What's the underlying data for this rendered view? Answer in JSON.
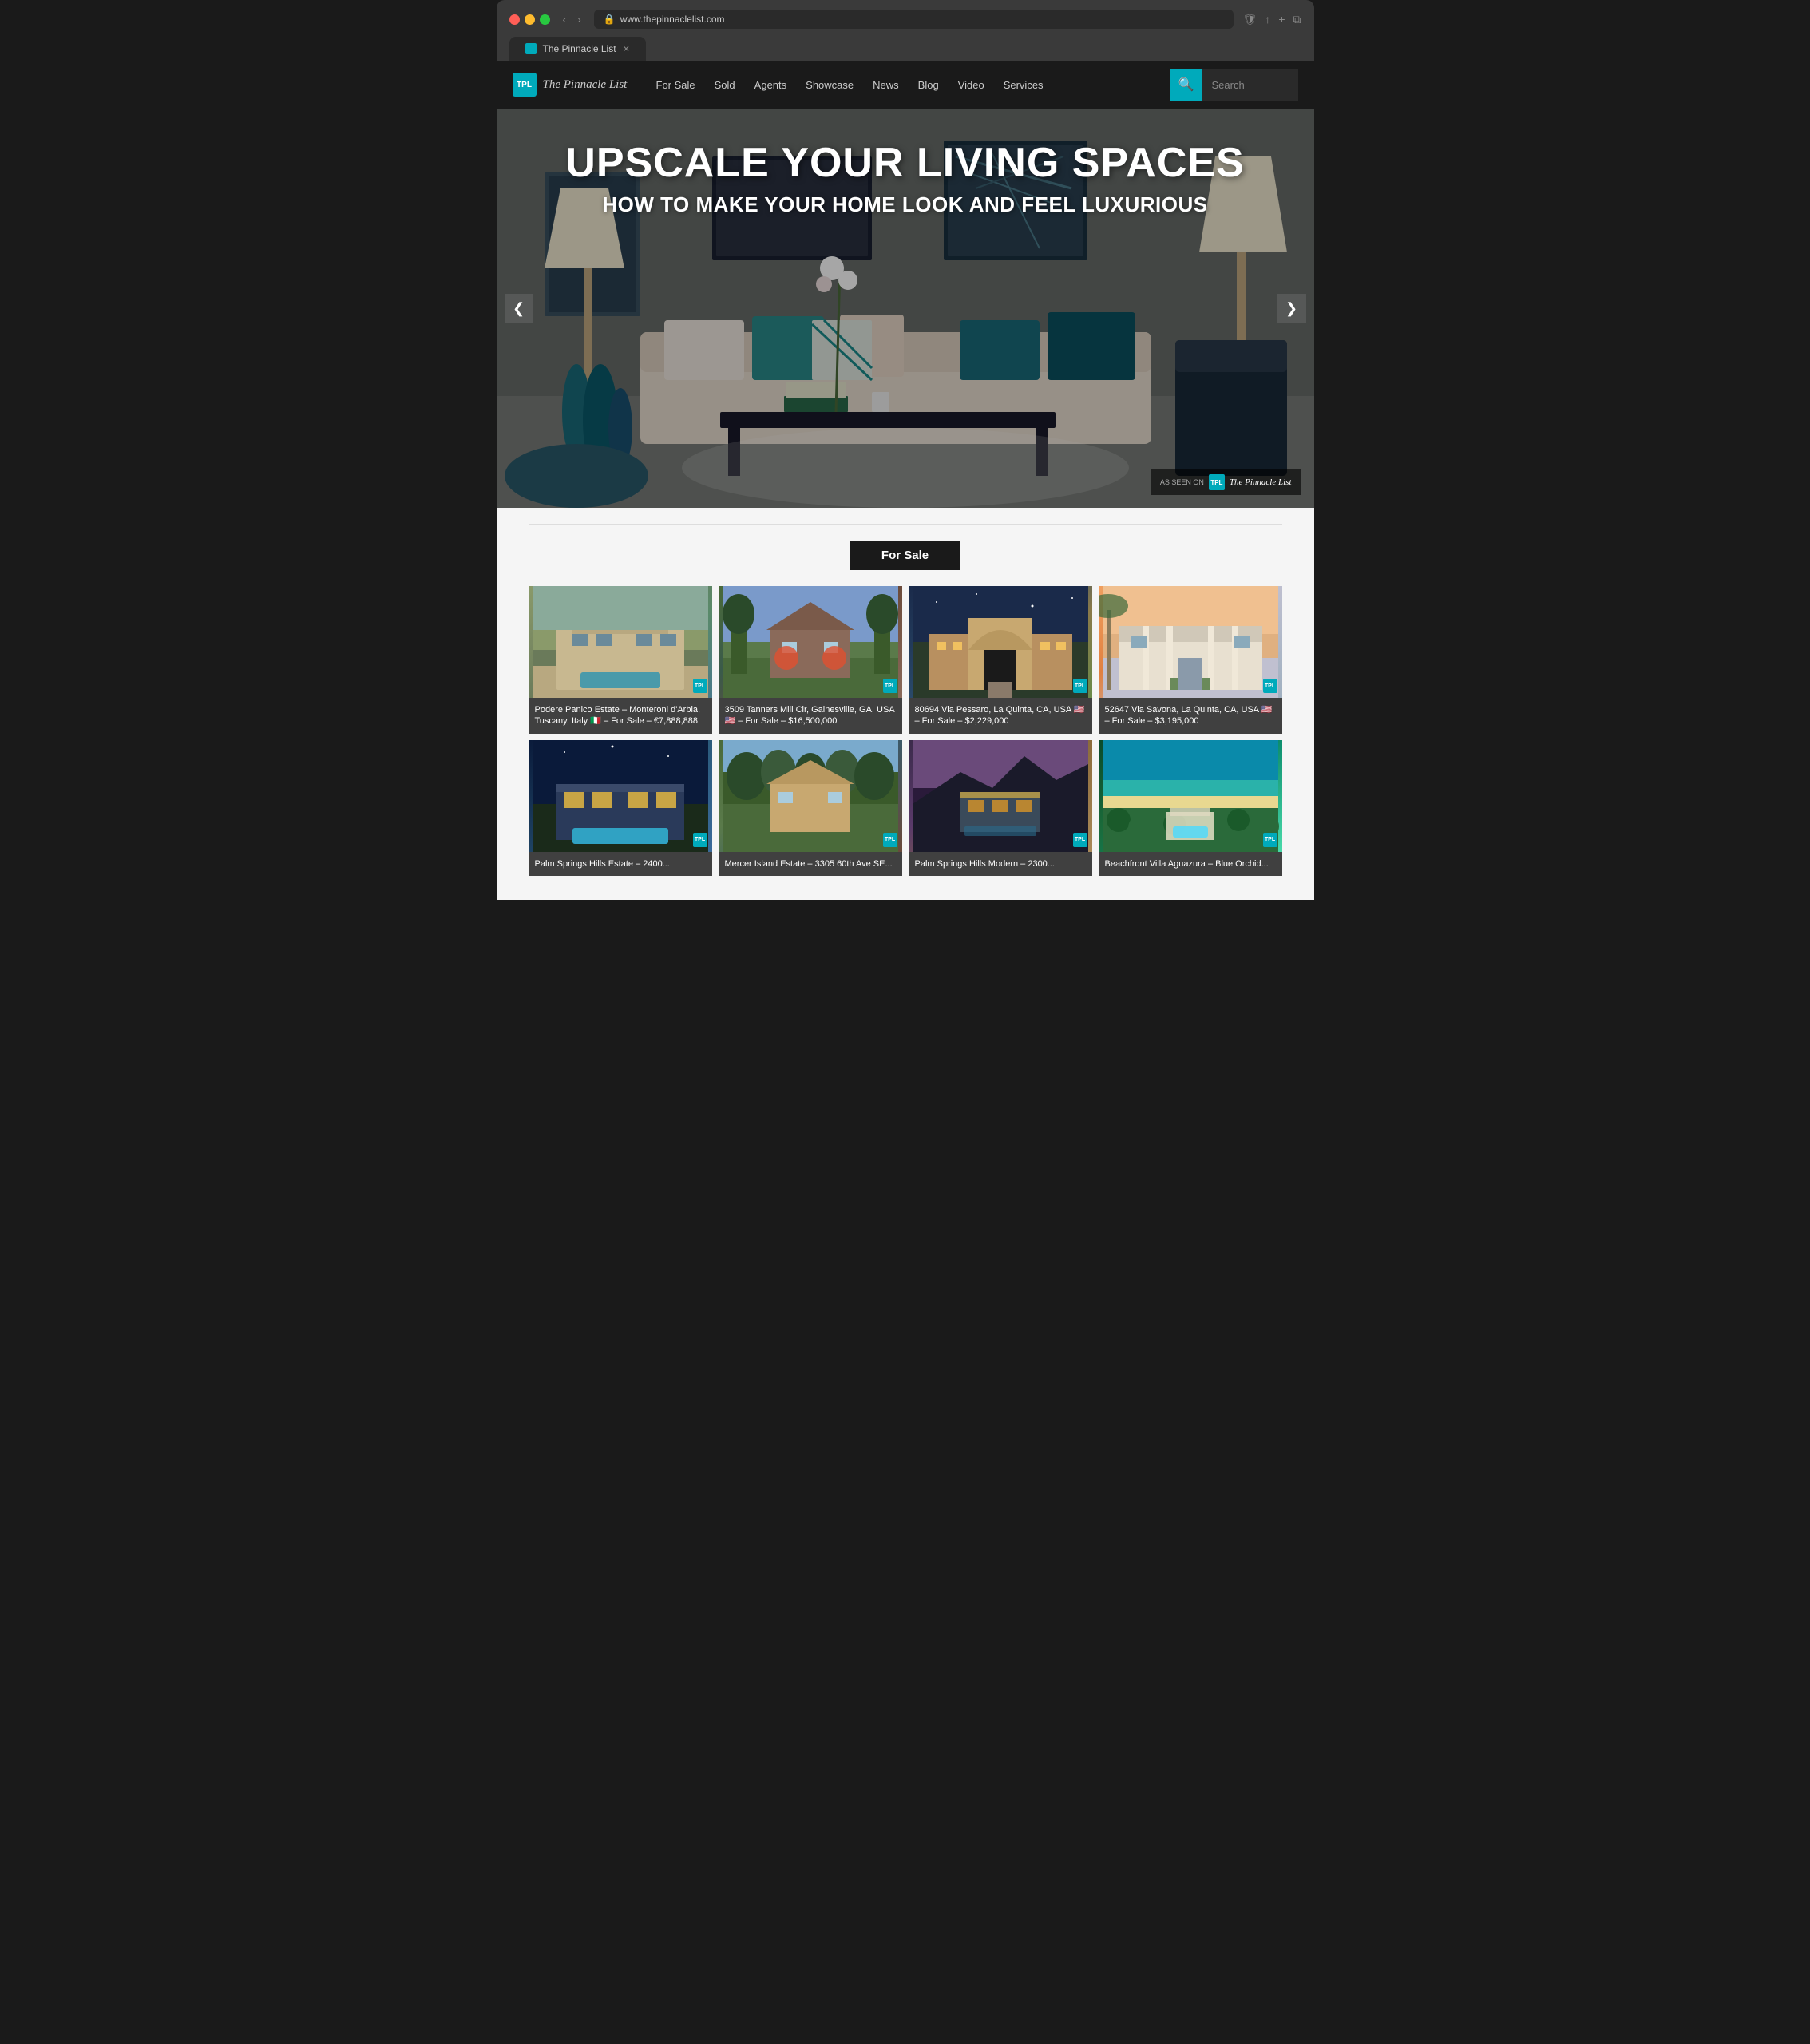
{
  "browser": {
    "url": "www.thepin naclelist.com",
    "url_display": "www.thepin naclelist.com",
    "tab_label": "The Pinnacle List",
    "prev_btn": "‹",
    "next_btn": "›"
  },
  "header": {
    "logo_initials": "TPL",
    "logo_line1": "The Pinnacle",
    "logo_line2": "List",
    "nav_items": [
      {
        "label": "For Sale",
        "key": "for-sale"
      },
      {
        "label": "Sold",
        "key": "sold"
      },
      {
        "label": "Agents",
        "key": "agents"
      },
      {
        "label": "Showcase",
        "key": "showcase"
      },
      {
        "label": "News",
        "key": "news"
      },
      {
        "label": "Blog",
        "key": "blog"
      },
      {
        "label": "Video",
        "key": "video"
      },
      {
        "label": "Services",
        "key": "services"
      }
    ],
    "search_placeholder": "Search"
  },
  "hero": {
    "title": "UPSCALE YOUR LIVING SPACES",
    "subtitle": "HOW TO MAKE YOUR HOME LOOK AND FEEL LUXURIOUS",
    "prev_label": "❮",
    "next_label": "❯",
    "watermark_as_seen": "AS SEEN ON",
    "watermark_icon": "TPL",
    "watermark_name": "The Pinnacle List"
  },
  "for_sale_section": {
    "title": "For Sale",
    "properties": [
      {
        "title": "Podere Panico Estate – Monteroni d'Arbia, Tuscany, Italy 🇮🇹 – For Sale – €7,888,888",
        "color_class": "prop-1"
      },
      {
        "title": "3509 Tanners Mill Cir, Gainesville, GA, USA 🇺🇸 – For Sale – $16,500,000",
        "color_class": "prop-2"
      },
      {
        "title": "80694 Via Pessaro, La Quinta, CA, USA 🇺🇸 – For Sale – $2,229,000",
        "color_class": "prop-3"
      },
      {
        "title": "52647 Via Savona, La Quinta, CA, USA 🇺🇸 – For Sale – $3,195,000",
        "color_class": "prop-4"
      },
      {
        "title": "Palm Springs Hills Estate – 2400...",
        "color_class": "prop-5"
      },
      {
        "title": "Mercer Island Estate – 3305 60th Ave SE...",
        "color_class": "prop-6"
      },
      {
        "title": "Palm Springs Hills Modern – 2300...",
        "color_class": "prop-7"
      },
      {
        "title": "Beachfront Villa Aguazura – Blue Orchid...",
        "color_class": "prop-8"
      }
    ]
  },
  "icons": {
    "search": "🔍",
    "lock": "🔒",
    "back": "‹",
    "forward": "›",
    "share": "↑",
    "new_tab": "+",
    "tabs": "⧉",
    "shield": "🛡",
    "prev_arrow": "❮",
    "next_arrow": "❯"
  }
}
